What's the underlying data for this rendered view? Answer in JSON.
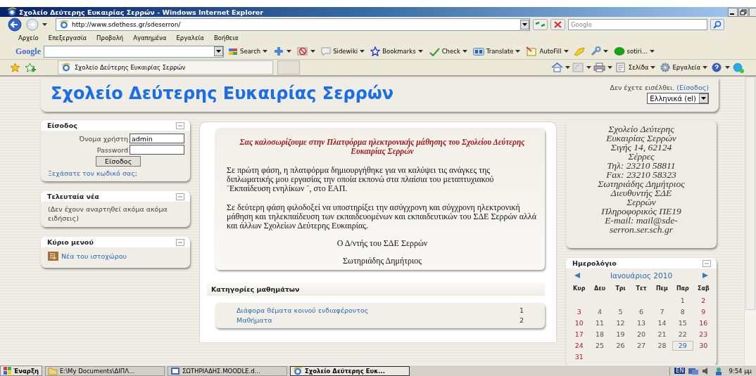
{
  "window": {
    "title": "Σχολείο Δεύτερης Ευκαιρίας Σερρών - Windows Internet Explorer"
  },
  "address_bar": {
    "url": "http://www.sdethess.gr/sdeserron/"
  },
  "search_box": {
    "placeholder": "Google"
  },
  "menu_bar": [
    "Αρχείο",
    "Επεξεργασία",
    "Προβολή",
    "Αγαπημένα",
    "Εργαλεία",
    "Βοήθεια"
  ],
  "google_toolbar": {
    "logo": "Google",
    "items": [
      {
        "kind": "search",
        "label": "Search"
      },
      {
        "kind": "sidewiki",
        "label": "Sidewiki"
      },
      {
        "kind": "bookmarks",
        "label": "Bookmarks"
      },
      {
        "kind": "check",
        "label": "Check"
      },
      {
        "kind": "translate",
        "label": "Translate"
      },
      {
        "kind": "autofill",
        "label": "AutoFill"
      },
      {
        "kind": "account",
        "label": "sotiri..."
      }
    ]
  },
  "favorites_bar": {
    "tab": "Σχολείο Δεύτερης Ευκαιρίας Σερρών"
  },
  "command_bar": [
    {
      "kind": "page",
      "label": "Σελίδα"
    },
    {
      "kind": "tools",
      "label": "Εργαλεία"
    }
  ],
  "page": {
    "site_title": "Σχολείο Δεύτερης Ευκαιρίας Σερρών",
    "login_info": {
      "text": "Δεν έχετε εισέλθει.",
      "link": "(Είσοδος)"
    },
    "language": "Ελληνικά (el)",
    "left_blocks": [
      {
        "kind": "login",
        "title": "Είσοδος",
        "username_label": "Όνομα χρήστη",
        "username": "admin",
        "password_label": "Password",
        "submit": "Είσοδος",
        "forgot_link": "Ξεχάσατε τον κωδικό σας;"
      },
      {
        "kind": "text",
        "title": "Τελευταία νέα",
        "text": "(Δεν έχουν αναρτηθεί ακόμα ακόμα ειδήσεις)"
      },
      {
        "kind": "links",
        "title": "Κύριο μενού",
        "links": [
          "Νέα του ιστοχώρου"
        ]
      }
    ],
    "welcome": {
      "heading": "Σας καλοσωρίζουμε στην Πλατφόρμα ηλεκτρονικής μάθησης του Σχολείου Δεύτερης Ευκαιρίας Σερρών",
      "paragraphs": [
        "Σε πρώτη φάση, η πλατφόρμα δημιουργήθηκε για να καλύψει τις ανάγκες της διπλωματικής μου εργασίας την οποία εκπονώ στα πλαίσια του μεταπτυχιακού ¨Εκπαίδευση ενηλίκων ¨, στο ΕΑΠ.",
        "Σε δεύτερη φάση φιλοδοξεί να υποστηρίξει την ασύγχρονη και σύγχρονη ηλεκτρονική μάθηση και τηλεκπαίδευση των εκπαιδευομένων και εκπαιδευτικών του ΣΔΕ Σερρών αλλά και άλλων Σχολείων Δεύτερης Ευκαιρίας."
      ],
      "signature": [
        "Ο Δ/ντής του ΣΔΕ Σερρών",
        "Σωτηριάδης Δημήτριος"
      ]
    },
    "categories": {
      "title": "Κατηγορίες μαθημάτων",
      "items": [
        {
          "name": "Διάφορα θέματα κοινού ενδιαφέροντος",
          "count": "1"
        },
        {
          "name": "Μαθήματα",
          "count": "2"
        }
      ]
    },
    "address_block": {
      "lines": [
        "Σχολείο Δεύτερης",
        "Ευκαιρίας Σερρών",
        "Σιγής 14, 62124",
        "Σέρρες",
        "Τηλ: 23210 58811",
        "Fax: 23210 58323",
        "Σωτηριάδης Δημήτριος",
        "Διευθυντής ΣΔΕ",
        "Σερρών",
        "Πληροφορικός ΠΕ19",
        "E-mail: mail@sde-",
        "serron.ser.sch.gr"
      ]
    },
    "calendar": {
      "title": "Ημερολόγιο",
      "month": "Ιανουάριος 2010",
      "weekdays": [
        "Κυρ",
        "Δευ",
        "Τρι",
        "Τετ",
        "Πεμ",
        "Παρ",
        "Σαβ"
      ],
      "weeks": [
        {
          "kind": "start",
          "days": [
            {
              "day": "1",
              "weekend": false,
              "selected": false
            },
            {
              "day": "2",
              "weekend": true,
              "selected": false
            }
          ]
        },
        {
          "kind": "full",
          "days": [
            {
              "day": "3",
              "weekend": true,
              "selected": false
            },
            {
              "day": "4",
              "weekend": false,
              "selected": false
            },
            {
              "day": "5",
              "weekend": false,
              "selected": false
            },
            {
              "day": "6",
              "weekend": false,
              "selected": false
            },
            {
              "day": "7",
              "weekend": false,
              "selected": false
            },
            {
              "day": "8",
              "weekend": false,
              "selected": false
            },
            {
              "day": "9",
              "weekend": true,
              "selected": false
            }
          ]
        },
        {
          "kind": "full",
          "days": [
            {
              "day": "10",
              "weekend": true,
              "selected": false
            },
            {
              "day": "11",
              "weekend": false,
              "selected": false
            },
            {
              "day": "12",
              "weekend": false,
              "selected": false
            },
            {
              "day": "13",
              "weekend": false,
              "selected": false
            },
            {
              "day": "14",
              "weekend": false,
              "selected": false
            },
            {
              "day": "15",
              "weekend": false,
              "selected": false
            },
            {
              "day": "16",
              "weekend": true,
              "selected": false
            }
          ]
        },
        {
          "kind": "full",
          "days": [
            {
              "day": "17",
              "weekend": true,
              "selected": false
            },
            {
              "day": "18",
              "weekend": false,
              "selected": false
            },
            {
              "day": "19",
              "weekend": false,
              "selected": false
            },
            {
              "day": "20",
              "weekend": false,
              "selected": false
            },
            {
              "day": "21",
              "weekend": false,
              "selected": false
            },
            {
              "day": "22",
              "weekend": false,
              "selected": false
            },
            {
              "day": "23",
              "weekend": true,
              "selected": false
            }
          ]
        },
        {
          "kind": "full",
          "days": [
            {
              "day": "24",
              "weekend": true,
              "selected": false
            },
            {
              "day": "25",
              "weekend": false,
              "selected": false
            },
            {
              "day": "26",
              "weekend": false,
              "selected": false
            },
            {
              "day": "27",
              "weekend": false,
              "selected": false
            },
            {
              "day": "28",
              "weekend": false,
              "selected": false
            },
            {
              "day": "29",
              "weekend": false,
              "selected": true
            },
            {
              "day": "30",
              "weekend": true,
              "selected": false
            }
          ]
        },
        {
          "kind": "end",
          "days": [
            {
              "day": "31",
              "weekend": true,
              "selected": false
            }
          ]
        }
      ]
    }
  },
  "taskbar": {
    "start": "Έναρξη",
    "items": [
      {
        "kind": "folder",
        "label": "E:\\My Documents\\ΔΙΠΛ...",
        "selected": false
      },
      {
        "kind": "document",
        "label": "ΣΩΤΗΡΙΑΔΗΣ.MOODLE.d...",
        "selected": false
      },
      {
        "kind": "browser",
        "label": "Σχολείο Δεύτερης Ευκ...",
        "selected": true
      }
    ],
    "language": "EN",
    "clock": "9:54 μμ"
  }
}
